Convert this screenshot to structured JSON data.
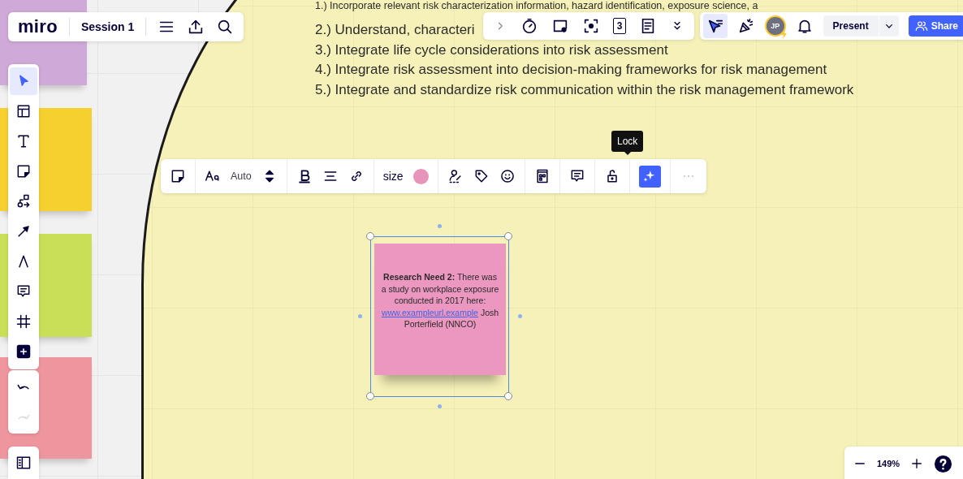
{
  "board_bar": {
    "logo": "miro",
    "board_name": "Session 1"
  },
  "canvas": {
    "left_stickies": [
      {
        "color": "#cfa9d8"
      },
      {
        "color": "#f5d02f"
      },
      {
        "color": "#cadf58"
      },
      {
        "color": "#ef959e"
      }
    ],
    "lines": [
      "1.) Incorporate relevant risk characterization information, hazard identification, exposure science, a",
      "2.) Understand, characteri",
      "3.) Integrate life cycle considerations into risk assessment",
      "4.) Integrate risk assessment into decision-making frameworks for risk management",
      "5.) Integrate and standardize risk communication within the risk management framework"
    ],
    "sticky_note": {
      "color": "#eb97c0",
      "text": "**Research Need 2:** There was a study on workplace exposure conducted in 2017 here:",
      "link": "www.exampleurl.example",
      "after": "Josh Porterfield (NNCO)",
      "selected": true
    }
  },
  "left_toolbar": [
    {
      "kind": "select",
      "selected": true
    },
    {
      "kind": "templates",
      "selected": false
    },
    {
      "kind": "text",
      "selected": false
    },
    {
      "kind": "sticky",
      "selected": false
    },
    {
      "kind": "shapes",
      "selected": false
    },
    {
      "kind": "arrow",
      "selected": false
    },
    {
      "kind": "pen",
      "selected": false
    },
    {
      "kind": "comment",
      "selected": false
    },
    {
      "kind": "frame",
      "selected": false
    },
    {
      "kind": "add",
      "selected": false
    }
  ],
  "history": [
    {
      "kind": "undo",
      "disabled": false
    },
    {
      "kind": "redo",
      "disabled": true
    }
  ],
  "apps_toolbar": [
    {
      "kind": "expand"
    },
    {
      "kind": "timer"
    },
    {
      "kind": "card"
    },
    {
      "kind": "focus"
    },
    {
      "kind": "counter",
      "text": "3"
    },
    {
      "kind": "notes"
    },
    {
      "kind": "more"
    }
  ],
  "collab_toolbar": {
    "cursor_mode_selected": true,
    "avatar": "JP",
    "present": "Present",
    "share": "Share"
  },
  "context_toolbar": {
    "font_size": "Auto",
    "size_label": "size",
    "color": "#e893b9",
    "tooltip": "Lock",
    "ai_selected": true
  },
  "zoom": {
    "level": "149%"
  }
}
